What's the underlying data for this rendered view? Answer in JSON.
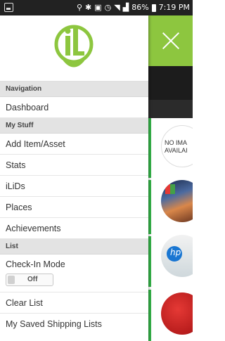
{
  "status_bar": {
    "battery": "86%",
    "time": "7:19 PM",
    "icons": [
      "image-notification-icon",
      "location-icon",
      "bluetooth-icon",
      "nfc-icon",
      "alarm-icon",
      "wifi-icon",
      "signal-icon",
      "battery-icon"
    ]
  },
  "logo": {
    "letters": "iL",
    "color": "#8dc63f"
  },
  "drawer": {
    "sections": [
      {
        "header": "Navigation",
        "items": [
          "Dashboard"
        ]
      },
      {
        "header": "My Stuff",
        "items": [
          "Add Item/Asset",
          "Stats",
          "iLiDs",
          "Places",
          "Achievements"
        ]
      },
      {
        "header": "List",
        "items": [
          "Check-In Mode",
          "Clear List",
          "My Saved Shipping Lists"
        ]
      }
    ],
    "check_in_toggle": "Off"
  },
  "background_app": {
    "header_color": "#8dc63f",
    "no_image_text_line1": "NO IMA",
    "no_image_text_line2": "AVAILAI"
  }
}
